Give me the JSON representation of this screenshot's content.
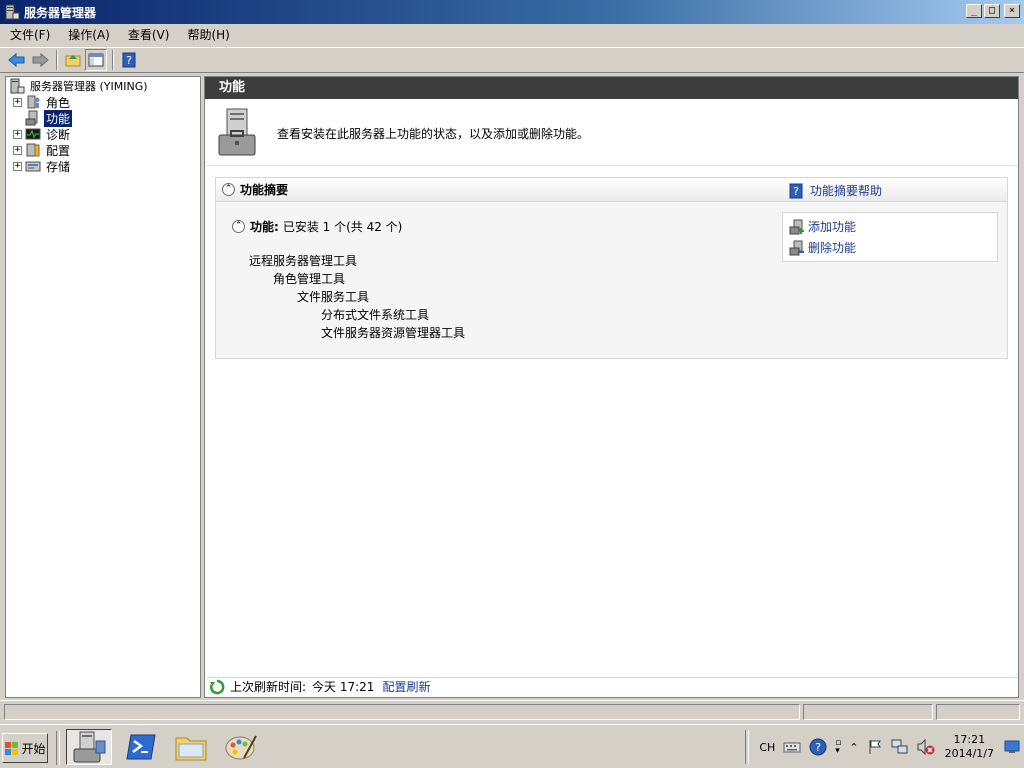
{
  "window": {
    "title": "服务器管理器",
    "minimize": "_",
    "maximize": "□",
    "close": "×"
  },
  "menu": [
    "文件(F)",
    "操作(A)",
    "查看(V)",
    "帮助(H)"
  ],
  "tree": {
    "root": "服务器管理器 (YIMING)",
    "items": [
      {
        "label": "角色",
        "expander": "+",
        "icon": "roles-icon"
      },
      {
        "label": "功能",
        "expander": "",
        "icon": "features-icon",
        "selected": true
      },
      {
        "label": "诊断",
        "expander": "+",
        "icon": "diagnostics-icon"
      },
      {
        "label": "配置",
        "expander": "+",
        "icon": "configuration-icon"
      },
      {
        "label": "存储",
        "expander": "+",
        "icon": "storage-icon"
      }
    ]
  },
  "content": {
    "header": "功能",
    "description": "查看安装在此服务器上功能的状态，以及添加或删除功能。",
    "summary": {
      "title": "功能摘要",
      "help_link": "功能摘要帮助",
      "features_label": "功能:",
      "features_status": "已安装 1 个(共 42 个)",
      "installed_tree": [
        {
          "label": "远程服务器管理工具",
          "level": 0
        },
        {
          "label": "角色管理工具",
          "level": 1
        },
        {
          "label": "文件服务工具",
          "level": 2
        },
        {
          "label": "分布式文件系统工具",
          "level": 3
        },
        {
          "label": "文件服务器资源管理器工具",
          "level": 3
        }
      ],
      "actions": [
        "添加功能",
        "删除功能"
      ]
    },
    "refresh": {
      "label": "上次刷新时间:",
      "time": "今天 17:21",
      "link": "配置刷新"
    }
  },
  "taskbar": {
    "start_label": "开始",
    "language": "CH",
    "clock_time": "17:21",
    "clock_date": "2014/1/7"
  },
  "colors": {
    "title_bar": "#0a246a",
    "header_bar": "#3d3d3d",
    "link": "#1f3b8c",
    "selection": "#0a246a"
  }
}
